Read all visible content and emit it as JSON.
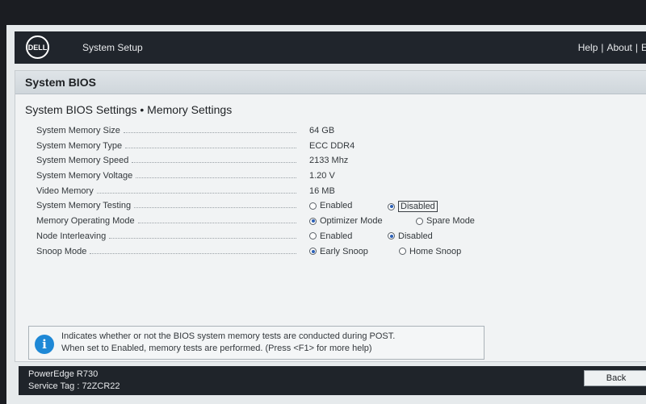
{
  "header": {
    "logo_text": "DELL",
    "title": "System Setup",
    "links": [
      "Help",
      "About",
      "Ex"
    ]
  },
  "panel": {
    "title": "System BIOS",
    "subtitle": "System BIOS Settings • Memory Settings"
  },
  "settings": [
    {
      "label": "System Memory Size",
      "value": "64 GB"
    },
    {
      "label": "System Memory Type",
      "value": "ECC DDR4"
    },
    {
      "label": "System Memory Speed",
      "value": "2133 Mhz"
    },
    {
      "label": "System Memory Voltage",
      "value": "1.20 V"
    },
    {
      "label": "Video Memory",
      "value": "16 MB"
    },
    {
      "label": "System Memory Testing",
      "options": [
        "Enabled",
        "Disabled"
      ],
      "selected": 1
    },
    {
      "label": "Memory Operating Mode",
      "options": [
        "Optimizer Mode",
        "Spare Mode"
      ],
      "selected": 0
    },
    {
      "label": "Node Interleaving",
      "options": [
        "Enabled",
        "Disabled"
      ],
      "selected": 1
    },
    {
      "label": "Snoop Mode",
      "options": [
        "Early Snoop",
        "Home Snoop"
      ],
      "selected": 0
    }
  ],
  "help": {
    "line1": "Indicates whether or not the BIOS system memory tests are conducted during POST.",
    "line2": "When set to Enabled, memory tests are performed. (Press <F1> for more help)"
  },
  "footer": {
    "model": "PowerEdge R730",
    "service_tag": "Service Tag : 72ZCR22",
    "back_label": "Back"
  },
  "colors": {
    "accent": "#1e88d6",
    "topbar": "#20252c",
    "selected_radio": "#2a5fb6"
  }
}
